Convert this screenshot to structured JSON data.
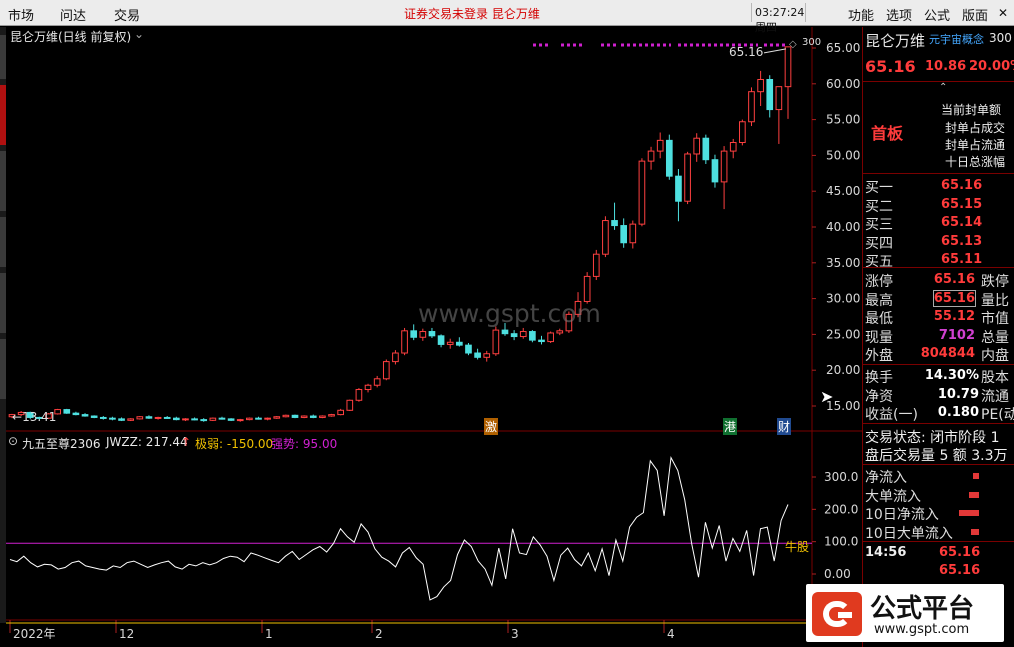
{
  "menu": {
    "market": "市场",
    "wenda": "问达",
    "trade": "交易",
    "function": "功能",
    "options": "选项",
    "formula": "公式",
    "layout": "版面"
  },
  "alert_text": "证券交易未登录  昆仑万维",
  "clock": "03:27:24 周四",
  "chart": {
    "title": "昆仑万维(日线 前复权)",
    "max_label": "65.16",
    "min_label": "13.41",
    "marks": {
      "ji": "激",
      "gang": "港",
      "cai": "财"
    },
    "indicator_title": "九五至尊2306",
    "jwzz_label": "JWZZ: 217.44",
    "up_arrow": "↑",
    "jiruo_label": "极弱: -150.00",
    "qiangshi_label": "强势: 95.00",
    "niugu_label": "牛股",
    "watermark": "www.gspt.com",
    "price_axis": [
      "65.00",
      "60.00",
      "55.00",
      "50.00",
      "45.00",
      "40.00",
      "35.00",
      "30.00",
      "25.00",
      "20.00",
      "15.00"
    ],
    "ind_axis": [
      "300.0",
      "200.0",
      "100.0",
      "0.00"
    ],
    "date_axis": [
      "2022年",
      "12",
      "1",
      "2",
      "3",
      "4"
    ],
    "colors": {
      "up": "#ff4040",
      "down": "#4ee0e0",
      "ind": "#ffffff",
      "pink": "#d020d0",
      "yellow": "#f0c000"
    }
  },
  "chart_data": {
    "type": "candlestick",
    "ylim": [
      13.41,
      65.16
    ],
    "candles": [
      [
        13.5,
        13.9,
        13.3,
        13.8
      ],
      [
        13.8,
        14.3,
        13.6,
        14.1
      ],
      [
        14.1,
        14.2,
        13.2,
        13.4
      ],
      [
        13.4,
        13.5,
        13.1,
        13.3
      ],
      [
        13.3,
        14.0,
        13.2,
        13.9
      ],
      [
        13.9,
        14.6,
        13.8,
        14.5
      ],
      [
        14.5,
        14.6,
        13.9,
        14.0
      ],
      [
        14.0,
        14.2,
        13.7,
        13.8
      ],
      [
        13.8,
        14.0,
        13.5,
        13.6
      ],
      [
        13.6,
        13.7,
        13.3,
        13.4
      ],
      [
        13.4,
        13.6,
        13.1,
        13.3
      ],
      [
        13.3,
        13.5,
        13.0,
        13.2
      ],
      [
        13.2,
        13.4,
        12.9,
        13.0
      ],
      [
        13.0,
        13.3,
        12.9,
        13.2
      ],
      [
        13.2,
        13.6,
        13.1,
        13.5
      ],
      [
        13.5,
        13.7,
        13.2,
        13.3
      ],
      [
        13.3,
        13.5,
        13.1,
        13.4
      ],
      [
        13.4,
        13.6,
        13.2,
        13.3
      ],
      [
        13.3,
        13.5,
        13.0,
        13.1
      ],
      [
        13.1,
        13.3,
        12.9,
        13.2
      ],
      [
        13.2,
        13.4,
        13.0,
        13.1
      ],
      [
        13.1,
        13.3,
        12.8,
        13.0
      ],
      [
        13.0,
        13.4,
        12.9,
        13.3
      ],
      [
        13.3,
        13.5,
        13.1,
        13.2
      ],
      [
        13.2,
        13.3,
        12.9,
        13.0
      ],
      [
        13.0,
        13.2,
        12.8,
        13.1
      ],
      [
        13.1,
        13.4,
        13.0,
        13.3
      ],
      [
        13.3,
        13.5,
        13.1,
        13.2
      ],
      [
        13.2,
        13.4,
        13.0,
        13.3
      ],
      [
        13.3,
        13.6,
        13.2,
        13.5
      ],
      [
        13.5,
        13.8,
        13.4,
        13.7
      ],
      [
        13.7,
        13.8,
        13.3,
        13.4
      ],
      [
        13.4,
        13.7,
        13.3,
        13.6
      ],
      [
        13.6,
        13.8,
        13.3,
        13.4
      ],
      [
        13.4,
        13.7,
        13.3,
        13.6
      ],
      [
        13.6,
        13.9,
        13.5,
        13.8
      ],
      [
        13.8,
        14.6,
        13.7,
        14.4
      ],
      [
        14.4,
        15.9,
        14.3,
        15.8
      ],
      [
        15.8,
        17.5,
        15.6,
        17.3
      ],
      [
        17.3,
        18.1,
        16.9,
        17.9
      ],
      [
        17.9,
        19.2,
        17.6,
        18.8
      ],
      [
        18.8,
        21.5,
        18.6,
        21.2
      ],
      [
        21.2,
        22.8,
        20.8,
        22.4
      ],
      [
        22.4,
        25.9,
        22.1,
        25.5
      ],
      [
        25.5,
        26.4,
        24.2,
        24.6
      ],
      [
        24.6,
        25.8,
        24.1,
        25.4
      ],
      [
        25.4,
        25.9,
        24.5,
        24.8
      ],
      [
        24.8,
        25.0,
        23.2,
        23.6
      ],
      [
        23.6,
        24.4,
        23.0,
        23.9
      ],
      [
        23.9,
        24.6,
        23.3,
        23.5
      ],
      [
        23.5,
        23.8,
        22.1,
        22.4
      ],
      [
        22.4,
        23.0,
        21.5,
        21.8
      ],
      [
        21.8,
        22.7,
        21.2,
        22.3
      ],
      [
        22.3,
        26.1,
        22.0,
        25.6
      ],
      [
        25.6,
        26.6,
        24.8,
        25.1
      ],
      [
        25.1,
        25.6,
        24.2,
        24.7
      ],
      [
        24.7,
        25.9,
        24.4,
        25.4
      ],
      [
        25.4,
        25.6,
        23.9,
        24.2
      ],
      [
        24.2,
        24.8,
        23.6,
        24.0
      ],
      [
        24.0,
        25.4,
        23.8,
        25.2
      ],
      [
        25.2,
        25.8,
        24.9,
        25.5
      ],
      [
        25.5,
        28.2,
        25.2,
        27.8
      ],
      [
        27.8,
        30.9,
        27.4,
        29.6
      ],
      [
        29.6,
        33.7,
        29.3,
        33.1
      ],
      [
        33.1,
        36.8,
        32.6,
        36.2
      ],
      [
        36.2,
        41.5,
        35.8,
        40.9
      ],
      [
        40.9,
        43.4,
        39.6,
        40.2
      ],
      [
        40.2,
        41.2,
        37.1,
        37.8
      ],
      [
        37.8,
        40.9,
        37.0,
        40.4
      ],
      [
        40.4,
        49.6,
        40.1,
        49.2
      ],
      [
        49.2,
        51.2,
        48.0,
        50.6
      ],
      [
        50.6,
        53.2,
        49.6,
        52.1
      ],
      [
        52.1,
        52.9,
        46.6,
        47.1
      ],
      [
        47.1,
        48.1,
        40.8,
        43.6
      ],
      [
        43.6,
        50.5,
        43.2,
        50.2
      ],
      [
        50.2,
        53.1,
        49.1,
        52.4
      ],
      [
        52.4,
        52.9,
        48.8,
        49.4
      ],
      [
        49.4,
        50.1,
        45.5,
        46.3
      ],
      [
        46.3,
        51.3,
        42.5,
        50.6
      ],
      [
        50.6,
        52.3,
        49.6,
        51.8
      ],
      [
        51.8,
        55.0,
        51.4,
        54.7
      ],
      [
        54.7,
        59.5,
        54.1,
        58.9
      ],
      [
        58.9,
        61.8,
        56.9,
        60.6
      ],
      [
        60.6,
        61.2,
        55.3,
        56.4
      ],
      [
        56.4,
        57.3,
        51.6,
        59.6
      ],
      [
        59.6,
        65.16,
        55.1,
        65.16
      ]
    ],
    "indicator": [
      45,
      38,
      55,
      35,
      22,
      30,
      28,
      15,
      20,
      35,
      40,
      25,
      20,
      15,
      12,
      25,
      20,
      35,
      40,
      30,
      20,
      28,
      35,
      40,
      22,
      15,
      30,
      25,
      35,
      28,
      35,
      48,
      55,
      52,
      38,
      65,
      58,
      50,
      42,
      35,
      55,
      70,
      45,
      60,
      75,
      85,
      68,
      95,
      140,
      115,
      98,
      155,
      130,
      78,
      52,
      40,
      22,
      65,
      82,
      50,
      30,
      -80,
      -70,
      -40,
      -20,
      60,
      105,
      85,
      40,
      15,
      -35,
      80,
      -15,
      140,
      65,
      60,
      115,
      90,
      55,
      -20,
      58,
      80,
      45,
      25,
      65,
      10,
      78,
      -5,
      105,
      40,
      145,
      175,
      190,
      350,
      320,
      180,
      360,
      320,
      230,
      95,
      -10,
      160,
      80,
      150,
      40,
      110,
      70,
      135,
      -5,
      140,
      145,
      40,
      165,
      215
    ],
    "bands": {
      "qiangshi": 95,
      "jiruo": -150
    }
  },
  "panel": {
    "name": "昆仑万维",
    "concept": "元宇宙概念",
    "code": "300",
    "price": "65.16",
    "change": "10.86",
    "pct": "20.00%",
    "board": "首板",
    "info_lines": [
      "当前封单额",
      "封单占成交",
      "封单占流通",
      "十日总涨幅"
    ],
    "bids": [
      {
        "l": "买一",
        "v": "65.16"
      },
      {
        "l": "买二",
        "v": "65.15"
      },
      {
        "l": "买三",
        "v": "65.14"
      },
      {
        "l": "买四",
        "v": "65.13"
      },
      {
        "l": "买五",
        "v": "65.11"
      }
    ],
    "quote_rows": [
      {
        "l": "涨停",
        "v": "65.16",
        "r": "跌停",
        "c": "red"
      },
      {
        "l": "最高",
        "v": "65.16",
        "r": "量比",
        "c": "red"
      },
      {
        "l": "最低",
        "v": "55.12",
        "r": "市值",
        "c": "red"
      },
      {
        "l": "现量",
        "v": "7102",
        "r": "总量",
        "c": "purple"
      },
      {
        "l": "外盘",
        "v": "804844",
        "r": "内盘",
        "c": "red"
      }
    ],
    "fin_rows": [
      {
        "l": "换手",
        "v": "14.30%",
        "r": "股本"
      },
      {
        "l": "净资",
        "v": "10.79",
        "r": "流通"
      },
      {
        "l": "收益(一)",
        "v": "0.180",
        "r": "PE(动"
      }
    ],
    "trade_status": "交易状态: 闭市阶段 1",
    "after_trade": "盘后交易量 5 额 3.3万",
    "flows": [
      {
        "l": "净流入",
        "w": 6
      },
      {
        "l": "大单流入",
        "w": 10
      },
      {
        "l": "10日净流入",
        "w": 20
      },
      {
        "l": "10日大单流入",
        "w": 8
      }
    ],
    "tick_time": "14:56",
    "tick_price1": "65.16",
    "tick_price2": "65.16"
  },
  "watermark_logo": "公式平台",
  "watermark_url": "www.gspt.com"
}
